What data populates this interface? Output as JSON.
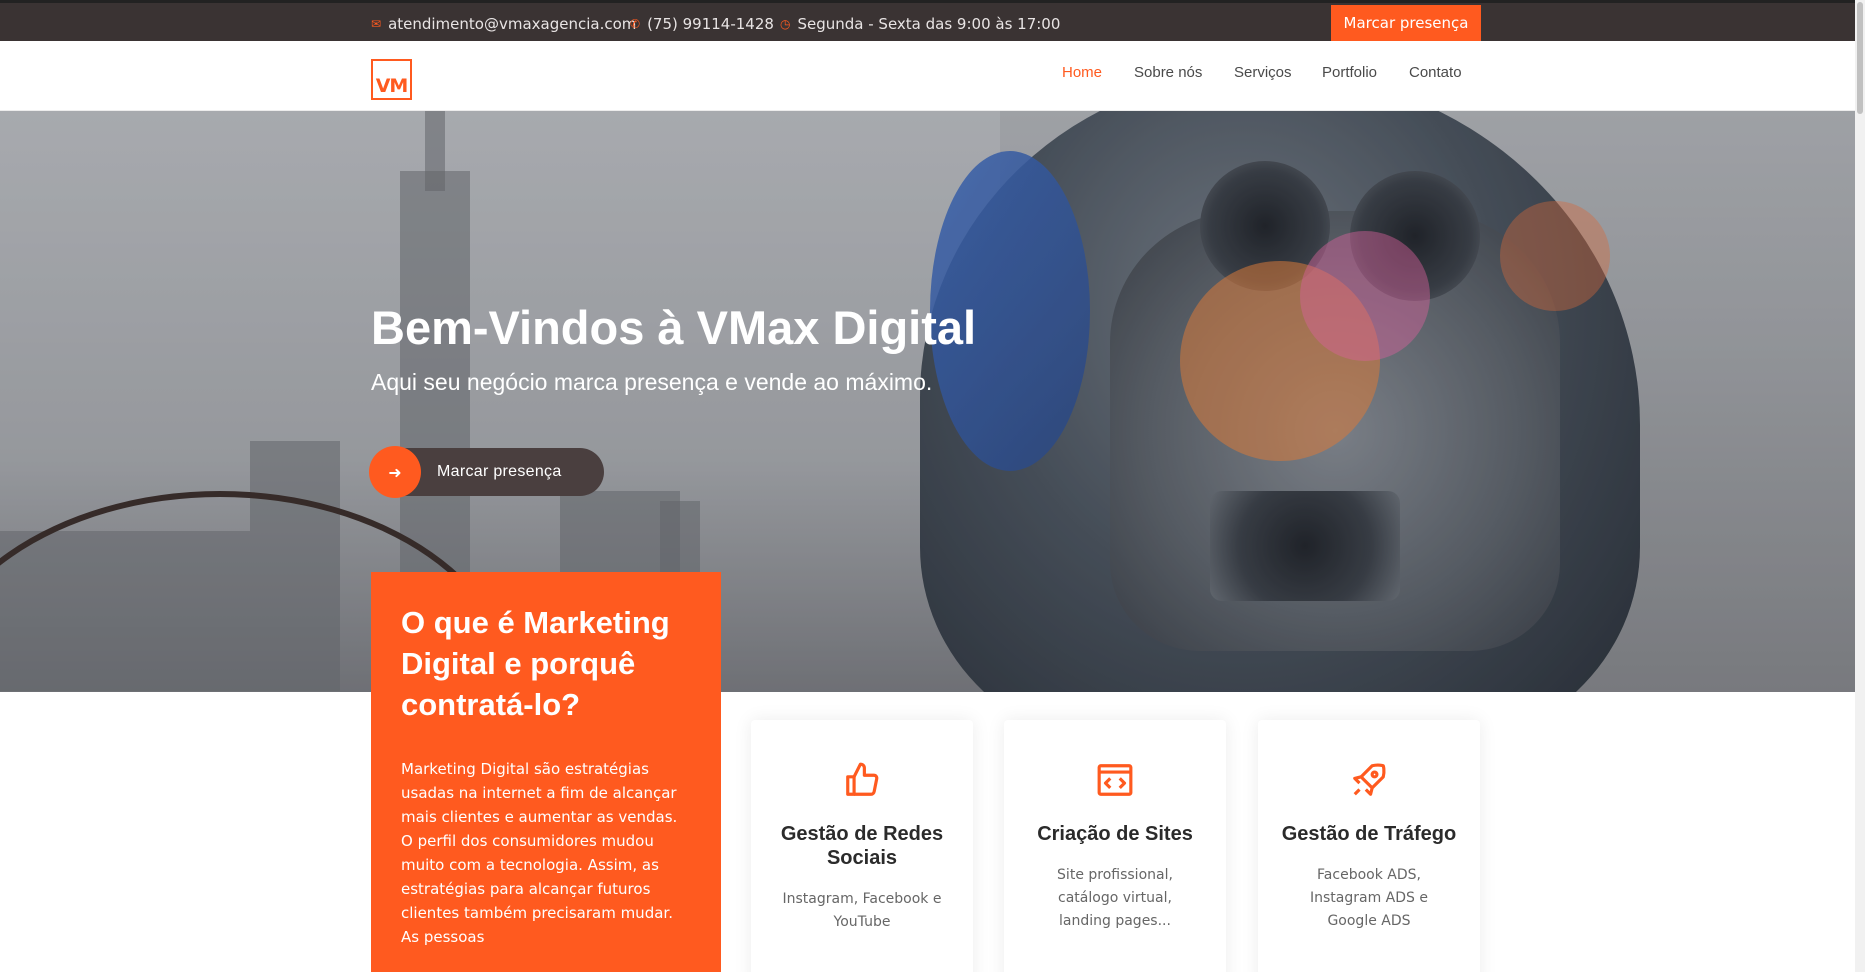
{
  "topbar": {
    "email": "atendimento@vmaxagencia.com",
    "phone": "(75) 99114-1428",
    "hours": "Segunda - Sexta das 9:00 às 17:00",
    "cta": "Marcar presença"
  },
  "nav": {
    "logo_text": "VM",
    "items": [
      "Home",
      "Sobre nós",
      "Serviços",
      "Portfolio",
      "Contato"
    ]
  },
  "hero": {
    "title": "Bem-Vindos à VMax Digital",
    "subtitle": "Aqui seu negócio marca presença e vende ao máximo.",
    "button": "Marcar presença"
  },
  "intro": {
    "title": "O que é Marketing Digital e porquê contratá-lo?",
    "text": "Marketing Digital são estratégias usadas na internet a fim de alcançar mais clientes e aumentar as vendas. O perfil dos consumidores mudou muito com a tecnologia. Assim, as estratégias para alcançar futuros clientes também precisaram mudar. As pessoas"
  },
  "services": [
    {
      "icon": "thumbs-up-icon",
      "title": "Gestão de Redes Sociais",
      "text": "Instagram, Facebook e YouTube"
    },
    {
      "icon": "code-window-icon",
      "title": "Criação de Sites",
      "text": "Site profissional, catálogo virtual, landing pages..."
    },
    {
      "icon": "rocket-icon",
      "title": "Gestão de Tráfego",
      "text": "Facebook ADS, Instagram ADS e Google ADS"
    }
  ],
  "colors": {
    "accent": "#ff5a1f",
    "topbar": "#3a3333"
  }
}
